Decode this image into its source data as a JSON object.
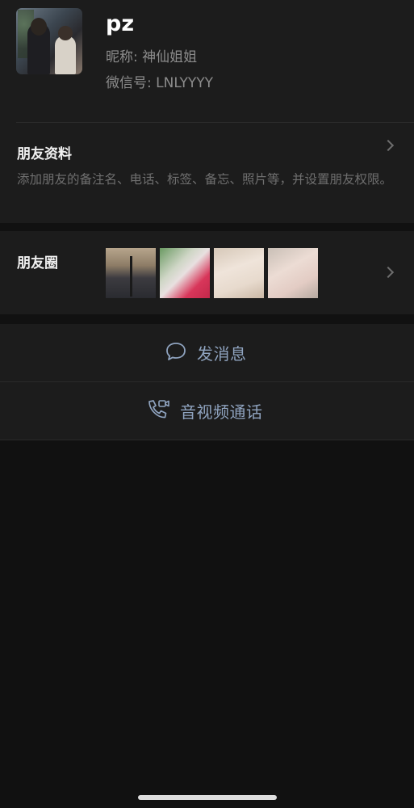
{
  "contact": {
    "name": "pz",
    "nickname": "昵称: 神仙姐姐",
    "wechat_id": "微信号: LNLYYYY"
  },
  "profile": {
    "title": "朋友资料",
    "description": "添加朋友的备注名、电话、标签、备忘、照片等，并设置朋友权限。"
  },
  "moments": {
    "title": "朋友圈",
    "thumbnail_count": 4
  },
  "actions": {
    "send_message": "发消息",
    "av_call": "音视频通话",
    "accent_color": "#8fa3bf"
  },
  "icons": [
    "chat-bubble-icon",
    "phone-video-icon",
    "chevron-right-icon"
  ]
}
